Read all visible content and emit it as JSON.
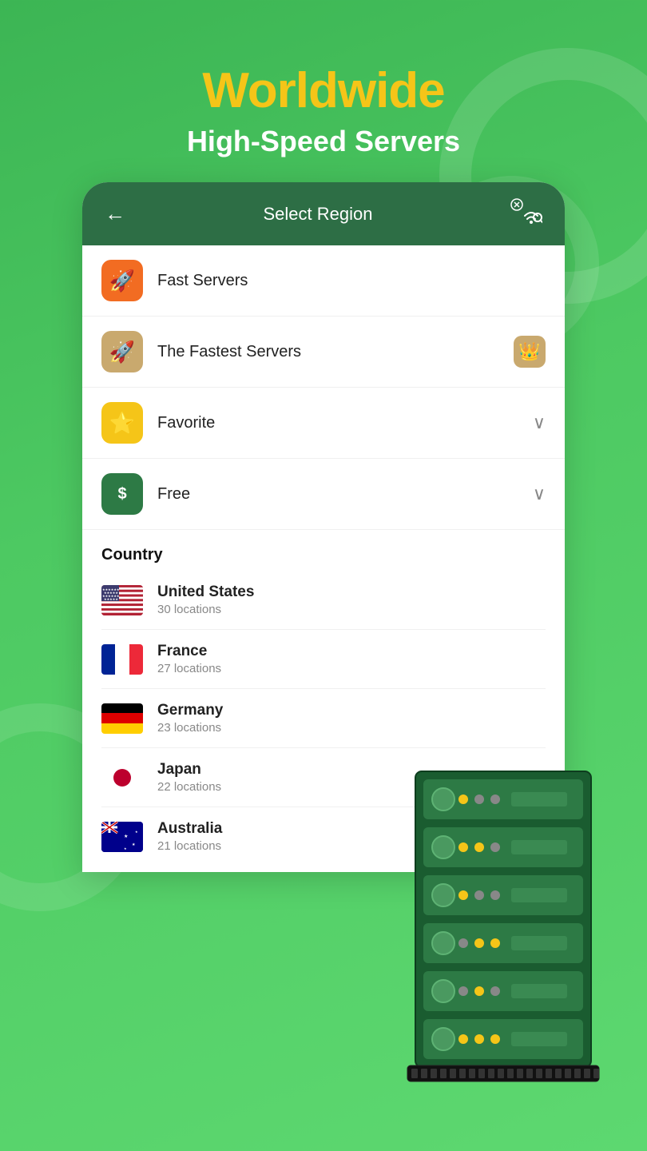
{
  "header": {
    "title": "Worldwide",
    "subtitle": "High-Speed Servers"
  },
  "card": {
    "title": "Select Region",
    "back_label": "←"
  },
  "menu": {
    "items": [
      {
        "label": "Fast Servers",
        "icon": "🚀",
        "icon_color": "orange",
        "right": ""
      },
      {
        "label": "The Fastest Servers",
        "icon": "🚀",
        "icon_color": "tan",
        "right": "crown"
      },
      {
        "label": "Favorite",
        "icon": "⭐",
        "icon_color": "yellow",
        "right": "chevron"
      },
      {
        "label": "Free",
        "icon": "$",
        "icon_color": "green",
        "right": "chevron"
      }
    ]
  },
  "country_section": {
    "heading": "Country",
    "countries": [
      {
        "name": "United States",
        "locations": "30 locations",
        "flag": "us"
      },
      {
        "name": "France",
        "locations": "27 locations",
        "flag": "fr"
      },
      {
        "name": "Germany",
        "locations": "23 locations",
        "flag": "de"
      },
      {
        "name": "Japan",
        "locations": "22 locations",
        "flag": "jp"
      },
      {
        "name": "Australia",
        "locations": "21 locations",
        "flag": "au"
      }
    ]
  }
}
